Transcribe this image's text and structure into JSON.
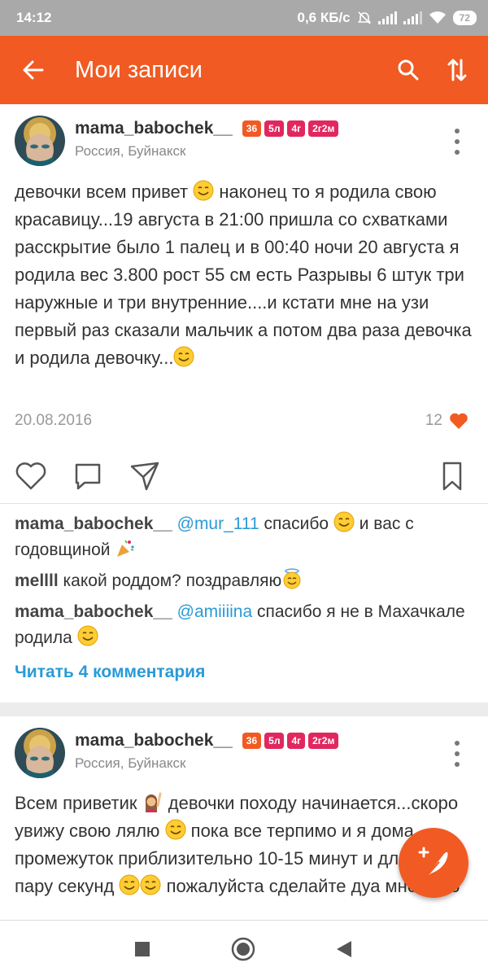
{
  "status_bar": {
    "time": "14:12",
    "net_speed": "0,6 КБ/с",
    "battery": "72"
  },
  "app_bar": {
    "title": "Мои записи",
    "back_icon": "arrow-left-icon",
    "search_icon": "search-icon",
    "sort_icon": "sort-arrows-icon"
  },
  "posts": [
    {
      "author": "mama_babochek__",
      "location": "Россия, Буйнакск",
      "badges": [
        "36",
        "5л",
        "4г",
        "2г2м"
      ],
      "text_parts": [
        "девочки всем привет ",
        " наконец то я родила свою красавицу...19 августа в 21:00 пришла со схватками расскрытие было 1 палец и в 00:40 ночи 20 августа я родила вес 3.800 рост 55 см есть Разрывы 6 штук три наружные и три внутренние....и кстати мне на узи первый раз сказали мальчик а потом два раза девочка и родила девочку..."
      ],
      "date": "20.08.2016",
      "likes": "12",
      "comments": [
        {
          "author": "mama_babochek__",
          "mention": "@mur_111",
          "text_before": " спасибо ",
          "text_after": " и вас с годовщиной "
        },
        {
          "author": "mellll",
          "text": " какой роддом? поздравляю"
        },
        {
          "author": "mama_babochek__",
          "mention": "@amiiiina",
          "text_before": " спасибо я не в Махачкале родила ",
          "text_after": ""
        }
      ],
      "read_more": "Читать 4 комментария"
    },
    {
      "author": "mama_babochek__",
      "location": "Россия, Буйнакск",
      "badges": [
        "36",
        "5л",
        "4г",
        "2г2м"
      ],
      "text_parts": [
        "Всем приветик ",
        " девочки походу начинается...скоро увижу свою лялю ",
        " пока все терпимо и я дома промежуток приблизительно 10-15 минут и длится пару секунд ",
        " пожалуйста сделайте дуа мне чтоб"
      ]
    }
  ],
  "colors": {
    "accent": "#f15a22",
    "badge_pink": "#e0285f",
    "link": "#2a9ad7",
    "heart": "#f15a22"
  },
  "fab_icon": "feather-plus-icon"
}
